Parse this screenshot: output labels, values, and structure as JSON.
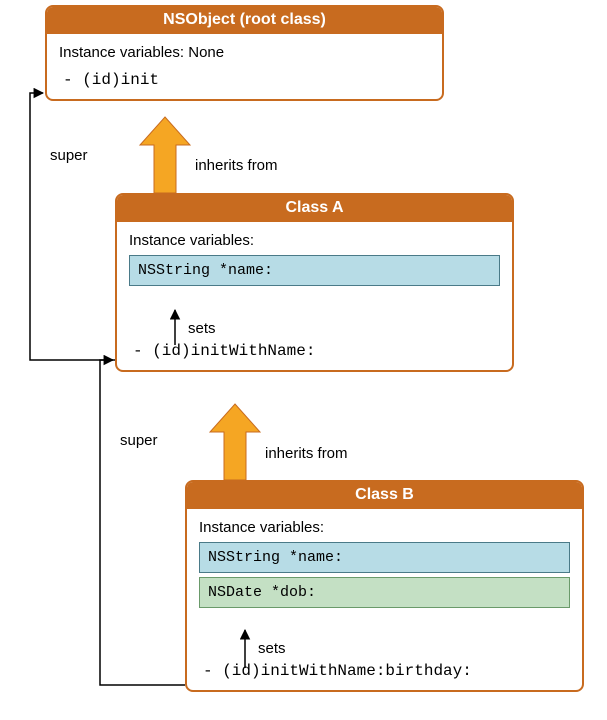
{
  "nsobject": {
    "title": "NSObject (root class)",
    "ivar_label": "Instance variables: None",
    "method": "- (id)init"
  },
  "classA": {
    "title": "Class A",
    "ivar_label": "Instance variables:",
    "ivar1": "NSString *name:",
    "method": "- (id)initWithName:"
  },
  "classB": {
    "title": "Class B",
    "ivar_label": "Instance variables:",
    "ivar1": "NSString *name:",
    "ivar2": "NSDate *dob:",
    "method": "- (id)initWithName:birthday:"
  },
  "labels": {
    "super1": "super",
    "super2": "super",
    "inherits1": "inherits from",
    "inherits2": "inherits from",
    "sets1": "sets",
    "sets2": "sets"
  }
}
